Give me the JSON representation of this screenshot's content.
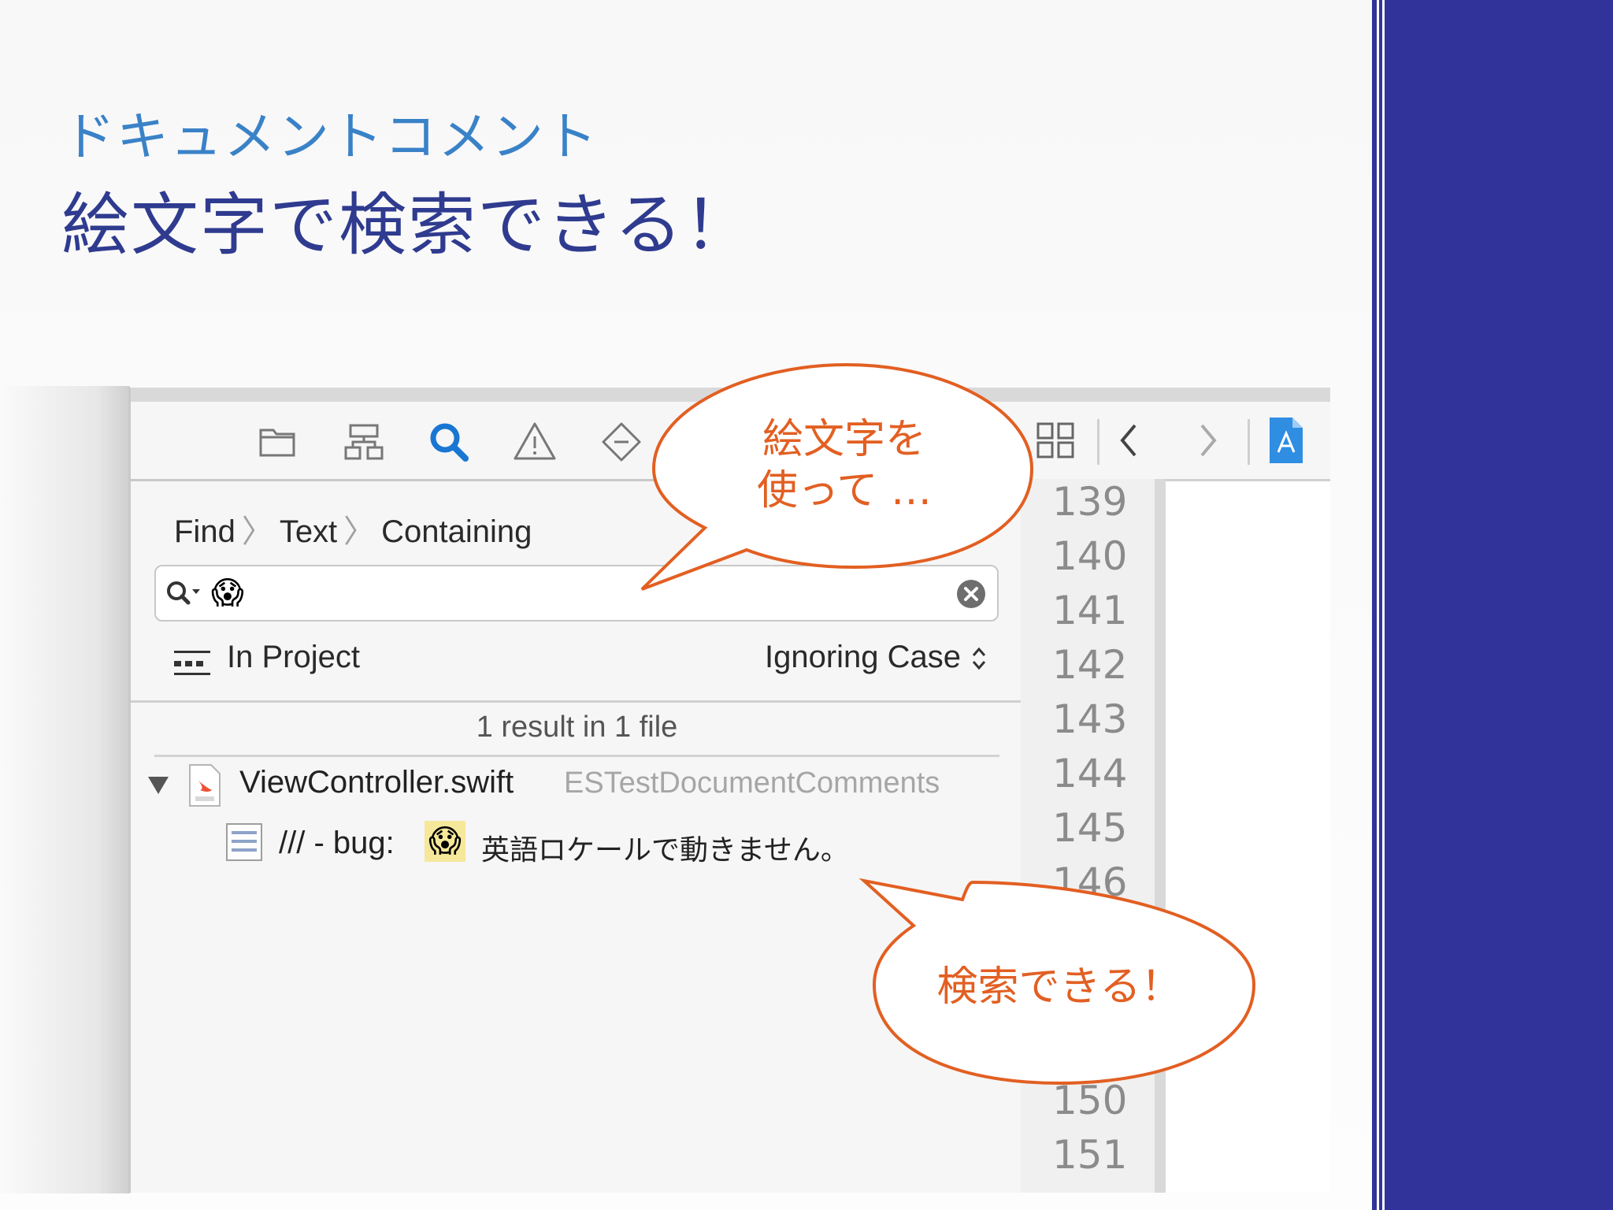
{
  "slide": {
    "subtitle": "ドキュメントコメント",
    "title": "絵文字で検索できる！"
  },
  "navigator": {
    "toolbar_icons": [
      "folder-icon",
      "hierarchy-icon",
      "search-icon",
      "warning-icon",
      "breakpoint-icon"
    ],
    "breadcrumb": [
      "Find",
      "Text",
      "Containing"
    ],
    "search": {
      "value": "😱"
    },
    "scope_label": "In Project",
    "case_label": "Ignoring Case",
    "result_count": "1 result in 1 file",
    "file": {
      "name": "ViewController.swift",
      "project": "ESTestDocumentComments"
    },
    "match": {
      "prefix": "/// - bug:",
      "emoji": "😱",
      "text": "英語ロケールで動きません。"
    }
  },
  "editor": {
    "line_numbers": [
      "139",
      "140",
      "141",
      "142",
      "143",
      "144",
      "145",
      "146",
      "150",
      "151"
    ]
  },
  "callouts": {
    "top_line1": "絵文字を",
    "top_line2": "使って …",
    "bottom": "検索できる！"
  },
  "colors": {
    "title": "#2f3b8f",
    "subtitle": "#3a82c8",
    "callout": "#e25f22",
    "sidebar": "#32339a",
    "search_highlight": "#1976d2"
  }
}
